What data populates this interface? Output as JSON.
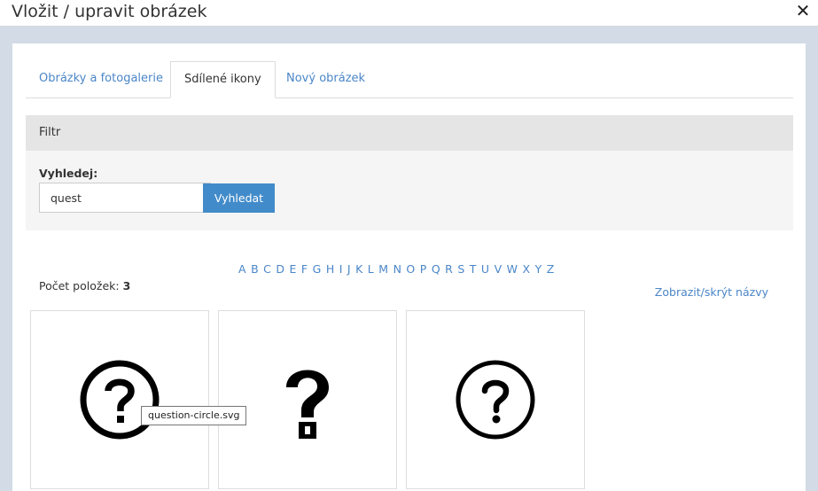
{
  "dialog": {
    "title": "Vložit / upravit obrázek",
    "close_glyph": "✕"
  },
  "tabs": [
    {
      "label": "Obrázky a fotogalerie",
      "active": false
    },
    {
      "label": "Sdílené ikony",
      "active": true
    },
    {
      "label": "Nový obrázek",
      "active": false
    }
  ],
  "filter": {
    "heading": "Filtr",
    "search_label": "Vyhledej:",
    "search_value": "quest",
    "search_button": "Vyhledat"
  },
  "alphabet": [
    "A",
    "B",
    "C",
    "D",
    "E",
    "F",
    "G",
    "H",
    "I",
    "J",
    "K",
    "L",
    "M",
    "N",
    "O",
    "P",
    "Q",
    "R",
    "S",
    "T",
    "U",
    "V",
    "W",
    "X",
    "Y",
    "Z"
  ],
  "results": {
    "count_label": "Počet položek:",
    "count_value": "3",
    "toggle_names": "Zobrazit/skrýt názvy",
    "items": [
      {
        "icon": "question-circle-icon"
      },
      {
        "icon": "question-mark-icon"
      },
      {
        "icon": "question-circle-icon"
      }
    ],
    "tooltip": "question-circle.svg"
  },
  "colors": {
    "link": "#4a86c8",
    "button": "#428bca",
    "frame": "#d2dbe6"
  }
}
